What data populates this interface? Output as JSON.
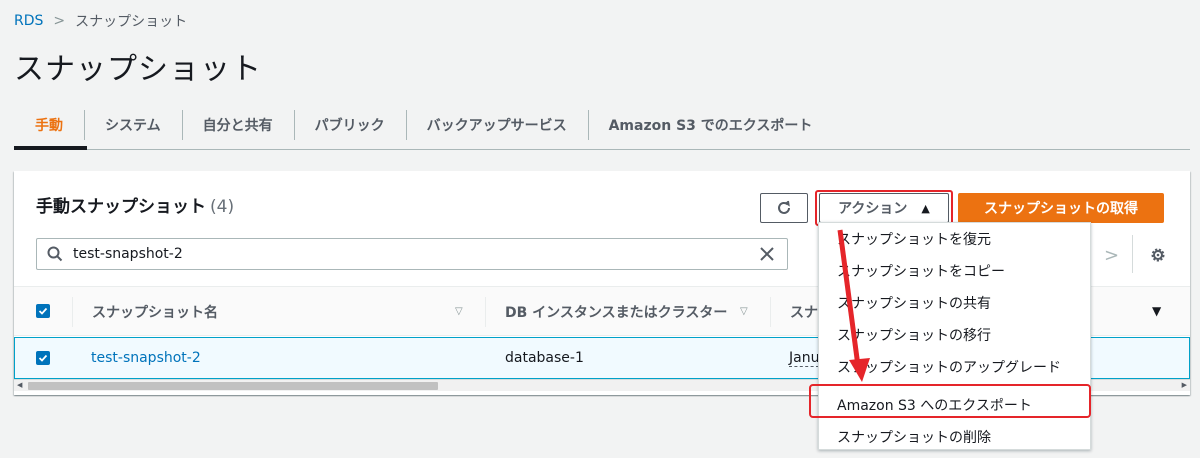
{
  "breadcrumb": {
    "root": "RDS",
    "current": "スナップショット"
  },
  "page_title": "スナップショット",
  "tabs": [
    {
      "label": "手動",
      "active": true
    },
    {
      "label": "システム"
    },
    {
      "label": "自分と共有"
    },
    {
      "label": "パブリック"
    },
    {
      "label": "バックアップサービス"
    },
    {
      "label": "Amazon S3 でのエクスポート"
    }
  ],
  "panel": {
    "title": "手動スナップショット",
    "count": "(4)",
    "actions_label": "アクション",
    "take_snapshot_label": "スナップショットの取得",
    "search_value": "test-snapshot-2"
  },
  "table": {
    "columns": [
      "スナップショット名",
      "DB インスタンスまたはクラスター",
      "スナ"
    ],
    "rows": [
      {
        "name": "test-snapshot-2",
        "instance": "database-1",
        "date": "Janu"
      }
    ]
  },
  "actions_menu": [
    "スナップショットを復元",
    "スナップショットをコピー",
    "スナップショットの共有",
    "スナップショットの移行",
    "スナップショットのアップグレード",
    "Amazon S3 へのエクスポート",
    "スナップショットの削除"
  ],
  "colors": {
    "accent": "#ec7211",
    "link": "#0073bb",
    "highlight": "#e5252a"
  }
}
